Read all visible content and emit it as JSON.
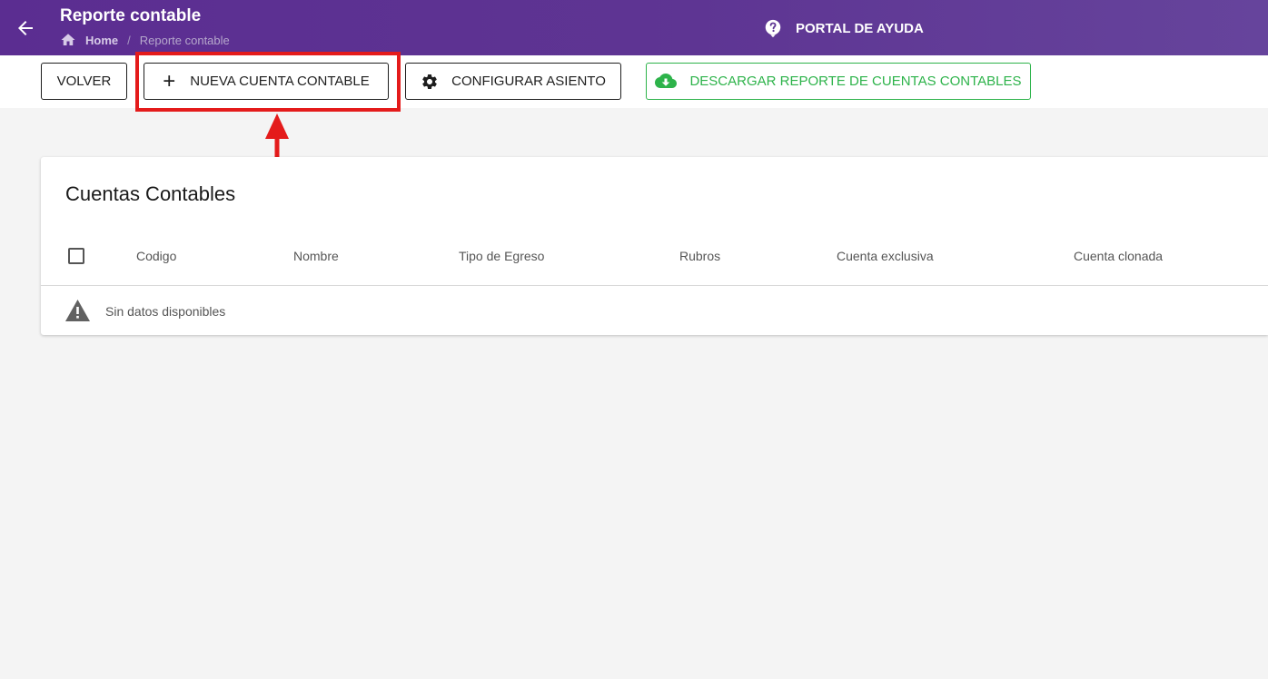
{
  "header": {
    "back_icon": "arrow-left-icon",
    "title": "Reporte contable",
    "breadcrumb": {
      "home_icon": "home-icon",
      "home": "Home",
      "separator": "/",
      "current": "Reporte contable"
    },
    "help": {
      "icon": "help-circle-icon",
      "label": "PORTAL DE AYUDA"
    }
  },
  "toolbar": {
    "volver": "VOLVER",
    "nueva": {
      "icon": "plus-icon",
      "plus": "+",
      "label": "NUEVA CUENTA CONTABLE"
    },
    "configurar": {
      "icon": "gear-icon",
      "label": "CONFIGURAR ASIENTO"
    },
    "descargar": {
      "icon": "cloud-download-icon",
      "label": "DESCARGAR REPORTE DE CUENTAS CONTABLES"
    }
  },
  "annotation": {
    "color": "#e41b1b",
    "highlight": "nueva-cuenta-contable-button"
  },
  "table": {
    "title": "Cuentas Contables",
    "columns": [
      "Codigo",
      "Nombre",
      "Tipo de Egreso",
      "Rubros",
      "Cuenta exclusiva",
      "Cuenta clonada"
    ],
    "empty_icon": "warning-icon",
    "empty_text": "Sin datos disponibles"
  },
  "colors": {
    "header": "#5b2d91",
    "download_accent": "#2db34a"
  }
}
